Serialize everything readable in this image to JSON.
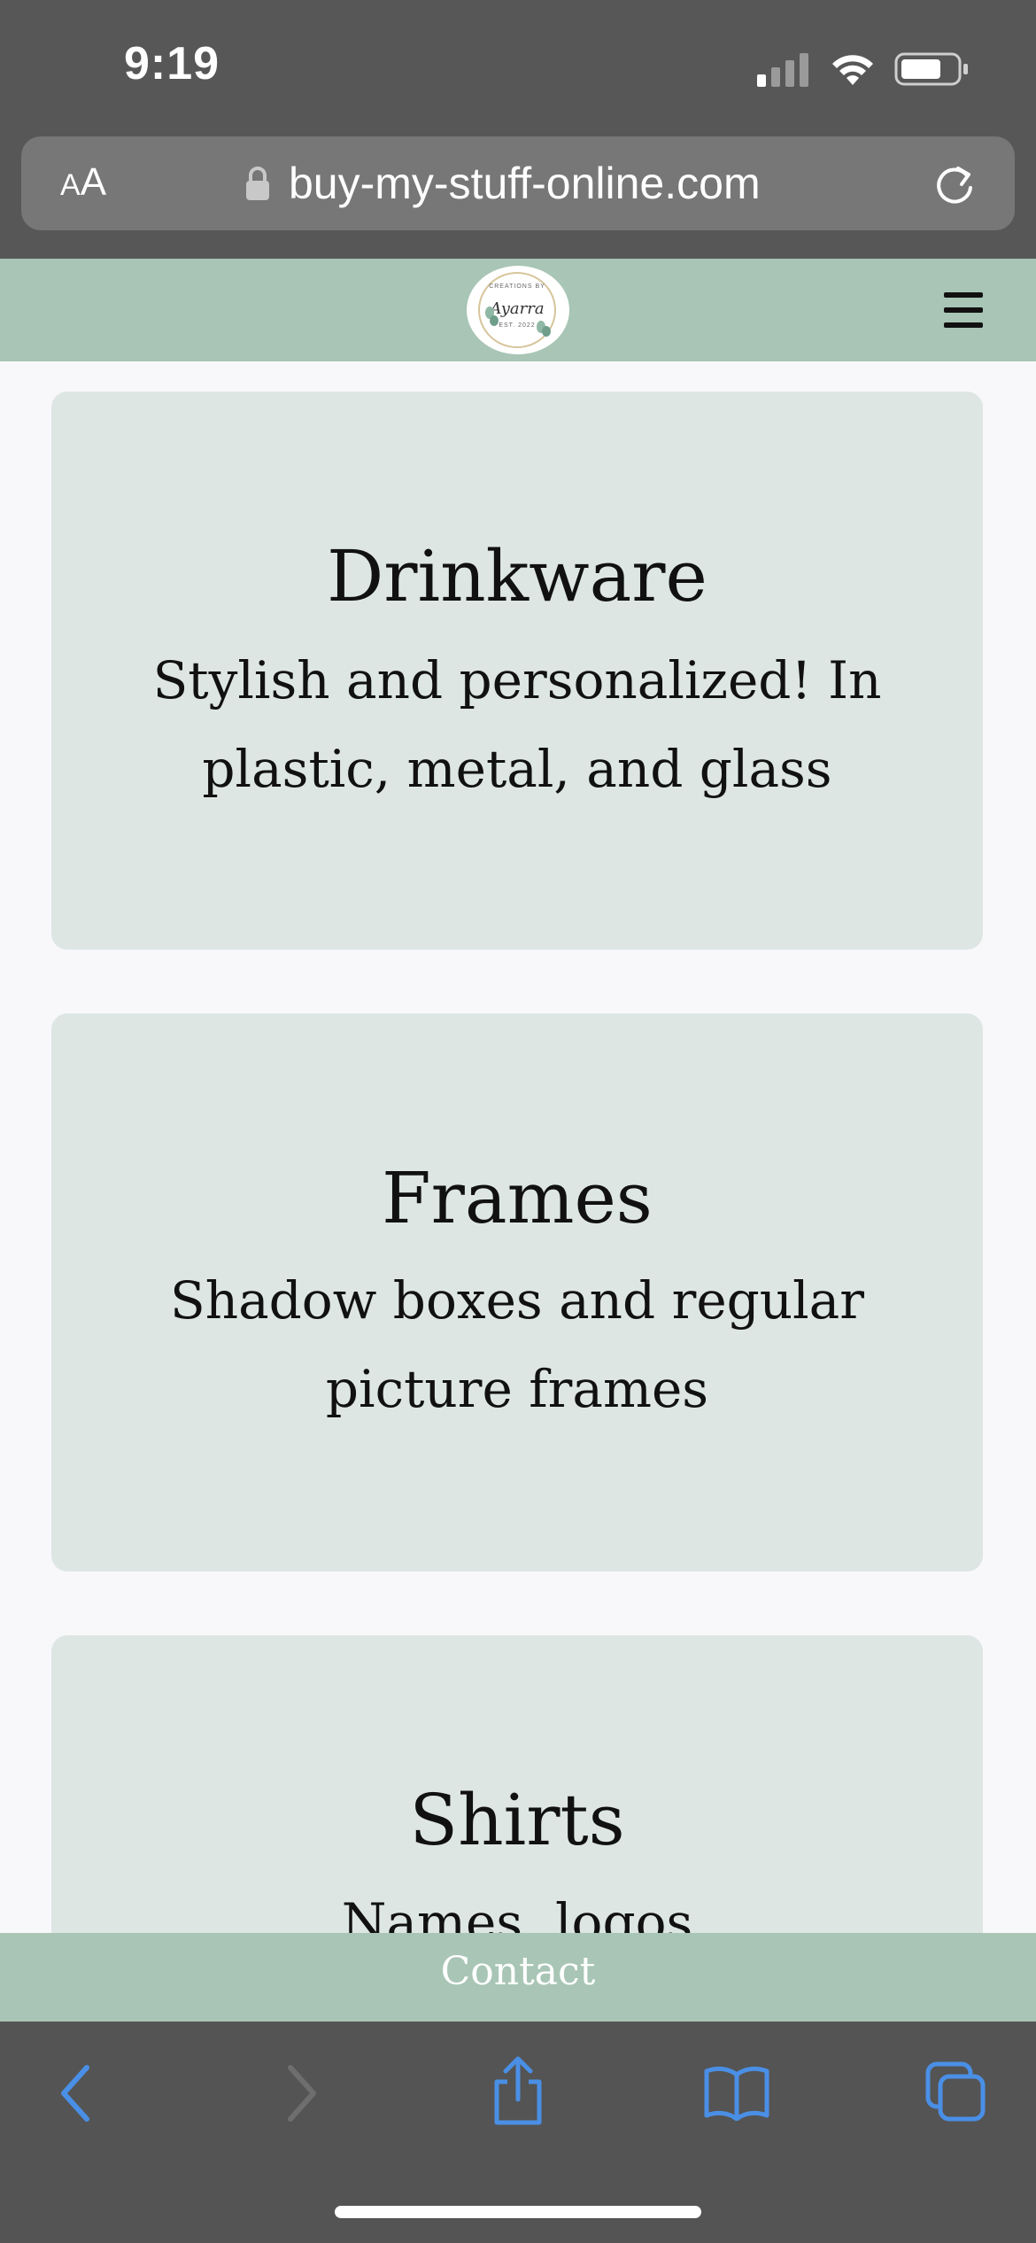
{
  "status_bar": {
    "time": "9:19"
  },
  "browser": {
    "aa_label_small": "A",
    "aa_label_large": "A",
    "url": "buy-my-stuff-online.com"
  },
  "site": {
    "logo": {
      "line1": "CREATIONS BY",
      "script": "Ayarra",
      "line2": "EST. 2022"
    }
  },
  "cards": [
    {
      "title": "Drinkware",
      "description": "Stylish and personalized! In plastic, metal, and glass"
    },
    {
      "title": "Frames",
      "description": "Shadow boxes and regular picture frames"
    },
    {
      "title": "Shirts",
      "description": "Names, logos"
    }
  ],
  "footer": {
    "contact_label": "Contact"
  },
  "colors": {
    "header_green": "#a8c5b5",
    "card_bg": "#dde6e3",
    "browser_chrome": "#575757",
    "toolbar_accent": "#4a8fe6"
  }
}
